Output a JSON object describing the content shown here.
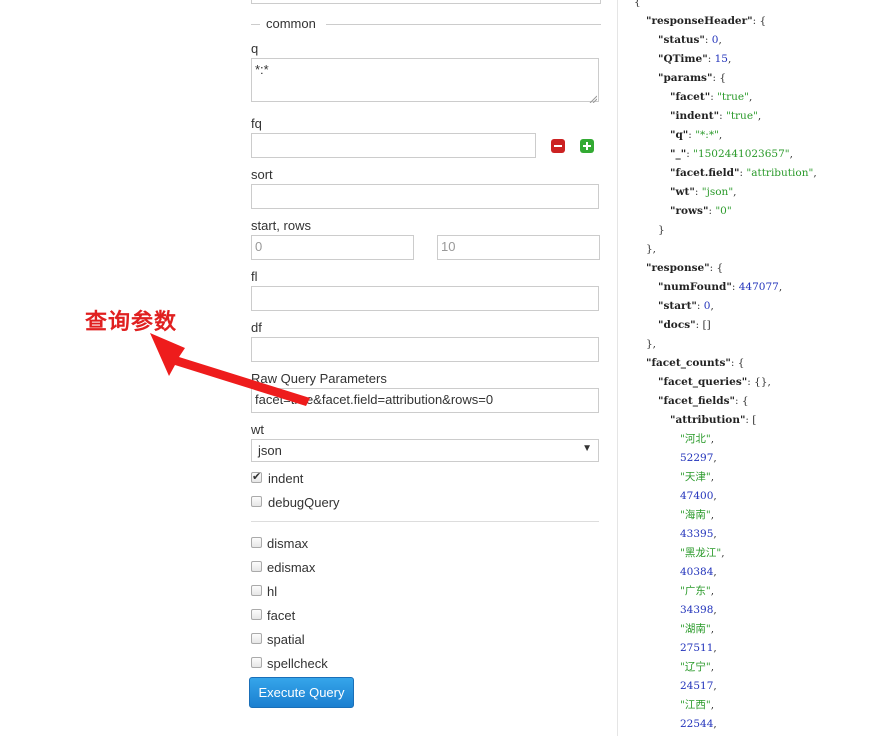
{
  "form": {
    "legend": "common",
    "q_label": "q",
    "q_value": "*:*",
    "fq_label": "fq",
    "sort_label": "sort",
    "start_rows_label": "start, rows",
    "start_placeholder": "0",
    "rows_placeholder": "10",
    "fl_label": "fl",
    "df_label": "df",
    "raw_label": "Raw Query Parameters",
    "raw_value": "facet=true&facet.field=attribution&rows=0",
    "wt_label": "wt",
    "wt_value": "json",
    "checkboxes": {
      "indent": "indent",
      "debugQuery": "debugQuery",
      "dismax": "dismax",
      "edismax": "edismax",
      "hl": "hl",
      "facet": "facet",
      "spatial": "spatial",
      "spellcheck": "spellcheck"
    },
    "execute_label": "Execute Query"
  },
  "annotation": "查询参数",
  "response_json": {
    "responseHeader": {
      "status": 0,
      "QTime": 15,
      "params": {
        "facet": "true",
        "indent": "true",
        "q": "*:*",
        "_": "1502441023657",
        "facet.field": "attribution",
        "wt": "json",
        "rows": "0"
      }
    },
    "response": {
      "numFound": 447077,
      "start": 0,
      "docs": "[]"
    },
    "facet_counts": {
      "facet_queries": "{}",
      "attribution": [
        {
          "name": "河北",
          "count": "52297"
        },
        {
          "name": "天津",
          "count": "47400"
        },
        {
          "name": "海南",
          "count": "43395"
        },
        {
          "name": "黑龙江",
          "count": "40384"
        },
        {
          "name": "广东",
          "count": "34398"
        },
        {
          "name": "湖南",
          "count": "27511"
        },
        {
          "name": "辽宁",
          "count": "24517"
        },
        {
          "name": "江西",
          "count": "22544"
        }
      ]
    }
  },
  "colors": {
    "accent": "#1b7fd0",
    "remove": "#cc2222",
    "add": "#33aa33",
    "annotation": "#e02020"
  }
}
